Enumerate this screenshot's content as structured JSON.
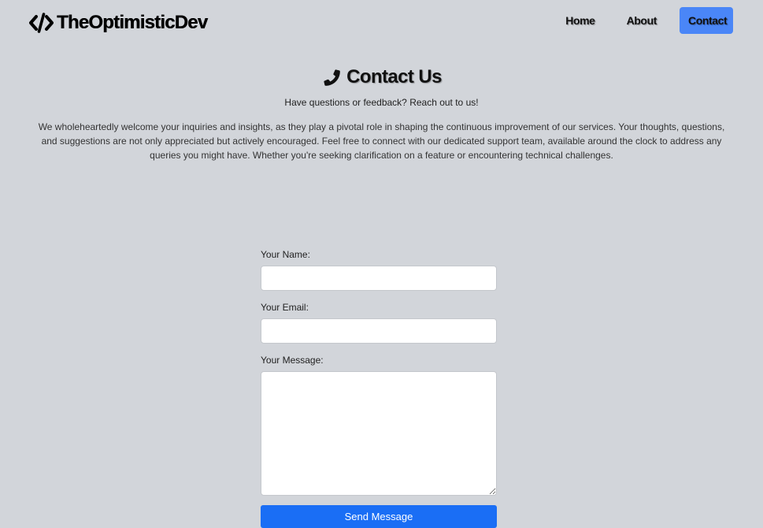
{
  "header": {
    "brand_name": "TheOptimisticDev",
    "brand_icon": "code-icon",
    "nav": [
      {
        "label": "Home",
        "active": false
      },
      {
        "label": "About",
        "active": false
      },
      {
        "label": "Contact",
        "active": true
      }
    ],
    "accent_color": "#4a86f7"
  },
  "main": {
    "title": "Contact Us",
    "title_icon": "phone-icon",
    "subtitle": "Have questions or feedback? Reach out to us!",
    "intro": "We wholeheartedly welcome your inquiries and insights, as they play a pivotal role in shaping the continuous improvement of our services. Your thoughts, questions, and suggestions are not only appreciated but actively encouraged. Feel free to connect with our dedicated support team, available around the clock to address any queries you might have. Whether you're seeking clarification on a feature or encountering technical challenges."
  },
  "form": {
    "name_label": "Your Name:",
    "name_value": "",
    "email_label": "Your Email:",
    "email_value": "",
    "message_label": "Your Message:",
    "message_value": "",
    "submit_label": "Send Message",
    "submit_color": "#1a6ef5"
  },
  "page": {
    "background": "#d2d5da"
  }
}
